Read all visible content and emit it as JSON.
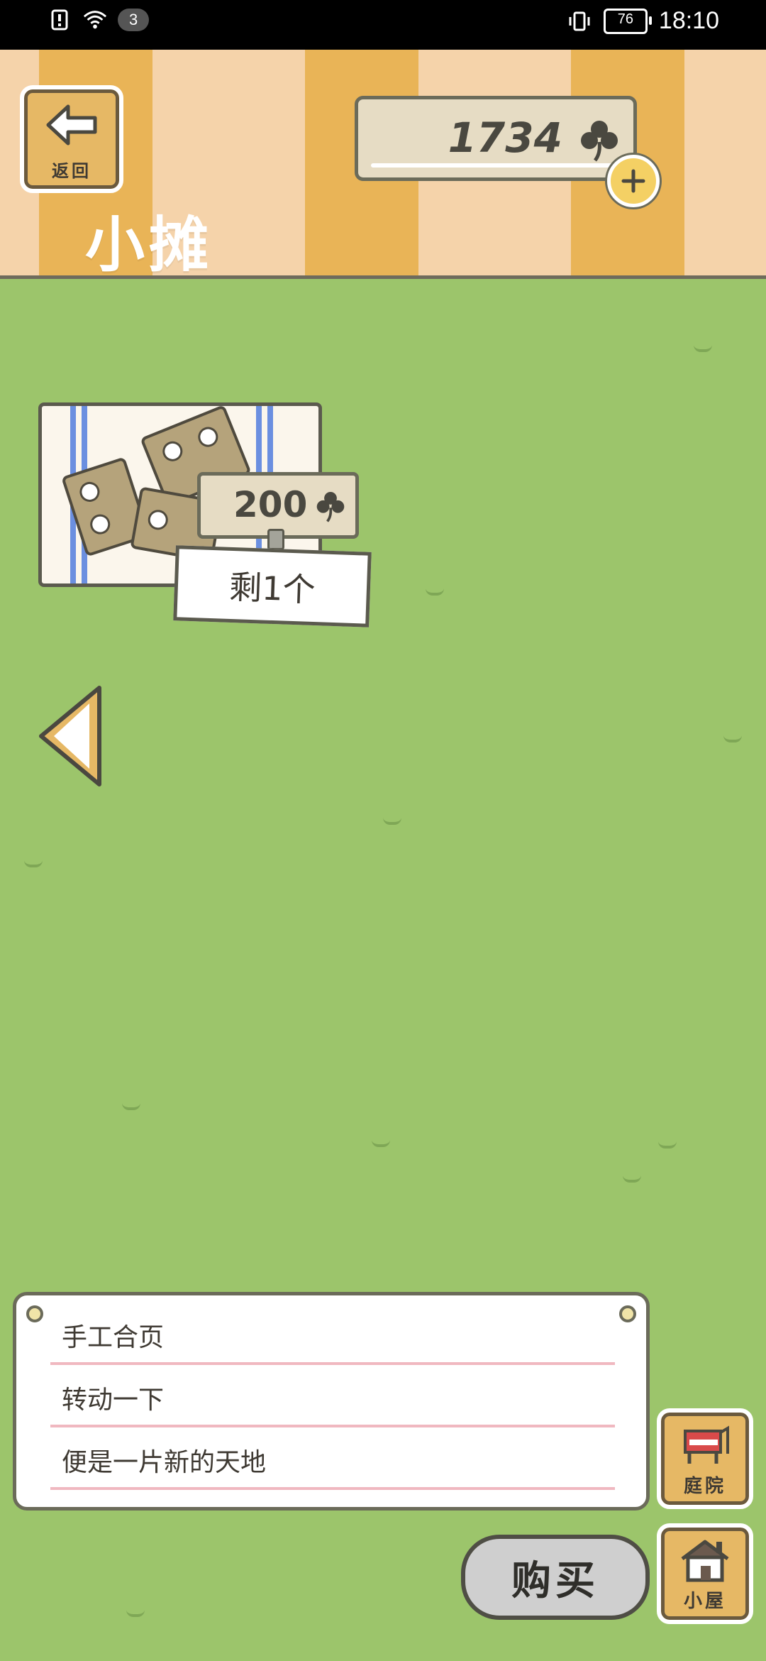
{
  "status_bar": {
    "notification_count": "3",
    "battery": "76",
    "time": "18:10"
  },
  "header": {
    "back_label": "返回",
    "title": "小摊",
    "currency_value": "1734"
  },
  "item": {
    "price": "200",
    "stock": "剩1个"
  },
  "description": {
    "lines": [
      "手工合页",
      "转动一下",
      "便是一片新的天地"
    ]
  },
  "buttons": {
    "courtyard_label": "庭院",
    "house_label": "小屋",
    "buy_label": "购买"
  },
  "colors": {
    "grass": "#9cc56b",
    "stripe_light": "#f5d3aa",
    "stripe_dark": "#e9b457",
    "wood": "#e6b865"
  }
}
